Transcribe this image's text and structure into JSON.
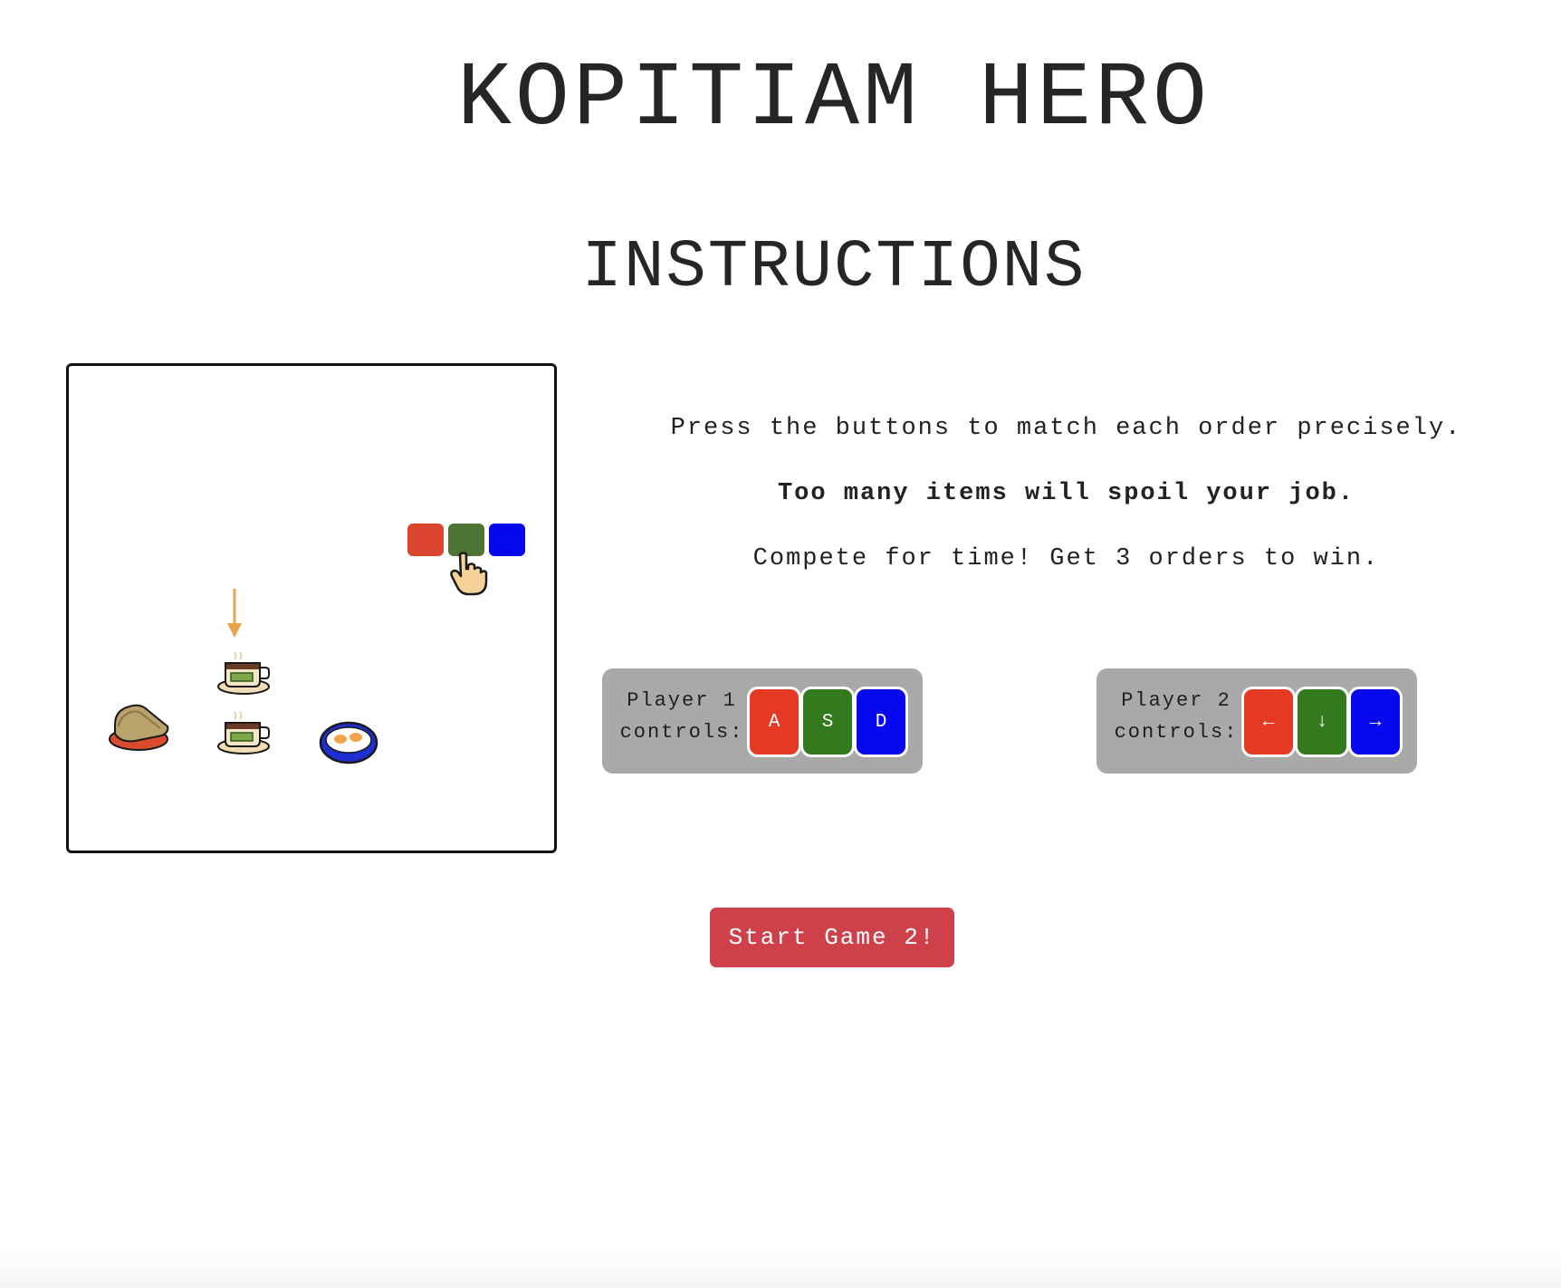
{
  "header": {
    "title": "KOPITIAM HERO",
    "subtitle": "INSTRUCTIONS"
  },
  "demo": {
    "button_colors": [
      "#dc4530",
      "#4e7434",
      "#0707ee"
    ],
    "items": [
      "toast-icon",
      "kopi-cup-icon",
      "kopi-cup-icon",
      "eggs-bowl-icon"
    ],
    "indicator": "arrow-down-icon",
    "pointer": "hand-pointer-icon"
  },
  "instructions": {
    "line1": "Press the buttons to match each order precisely.",
    "line2": "Too many items will spoil your job.",
    "line3": "Compete for time! Get 3 orders to win."
  },
  "player1": {
    "label_line1": "Player 1",
    "label_line2": "controls:",
    "keys": [
      "A",
      "S",
      "D"
    ]
  },
  "player2": {
    "label_line1": "Player 2",
    "label_line2": "controls:",
    "keys": [
      "←",
      "↓",
      "→"
    ]
  },
  "start_button": "Start Game 2!",
  "colors": {
    "red": "#e43a24",
    "green": "#33791d",
    "blue": "#0808ee",
    "start": "#cf414a",
    "panel": "#a9a9a9"
  }
}
